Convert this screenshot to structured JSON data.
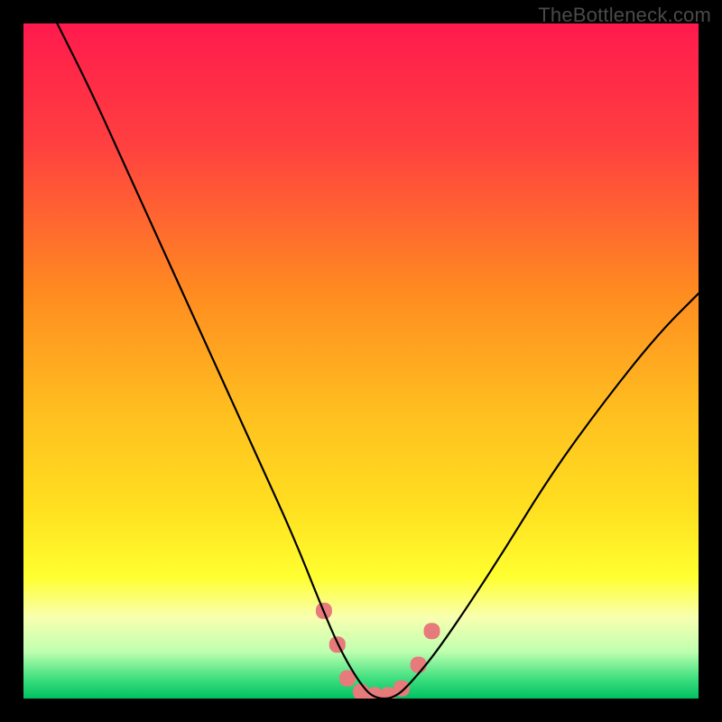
{
  "watermark": "TheBottleneck.com",
  "colors": {
    "frame": "#000000",
    "gradient_stops": [
      {
        "pos": 0.0,
        "color": "#ff1a4d"
      },
      {
        "pos": 0.18,
        "color": "#ff4040"
      },
      {
        "pos": 0.4,
        "color": "#ff8c20"
      },
      {
        "pos": 0.58,
        "color": "#ffc020"
      },
      {
        "pos": 0.72,
        "color": "#ffe020"
      },
      {
        "pos": 0.82,
        "color": "#ffff30"
      },
      {
        "pos": 0.88,
        "color": "#f8ffb0"
      },
      {
        "pos": 0.93,
        "color": "#c0ffb0"
      },
      {
        "pos": 0.97,
        "color": "#40e080"
      },
      {
        "pos": 1.0,
        "color": "#00c060"
      }
    ],
    "curve": "#000000",
    "marker_fill": "#e77a7a",
    "marker_stroke": "#d06060"
  },
  "chart_data": {
    "type": "line",
    "title": "",
    "xlabel": "",
    "ylabel": "",
    "xlim": [
      0,
      100
    ],
    "ylim": [
      0,
      100
    ],
    "note": "A bottleneck-style V curve. x is an implicit hardware-balance axis; y is bottleneck percentage (higher = worse, red; lower = better, green). Minimum near x≈52 at y=0. Values are read off pixel positions in a 748×748 plot area since no axes are labeled.",
    "series": [
      {
        "name": "bottleneck_curve",
        "x": [
          5,
          10,
          15,
          20,
          25,
          30,
          35,
          40,
          44,
          47,
          50,
          52,
          55,
          58,
          62,
          70,
          78,
          86,
          94,
          100
        ],
        "y": [
          100,
          90,
          79,
          68,
          57,
          46,
          35,
          24,
          14,
          7,
          2,
          0,
          0,
          3,
          8,
          20,
          33,
          44,
          54,
          60
        ]
      }
    ],
    "markers": {
      "name": "highlighted_points",
      "note": "Pink rounded markers clustered around the valley (left and right shoulders plus the flat bottom).",
      "x": [
        44.5,
        46.5,
        48,
        50,
        52,
        54,
        56,
        58.5,
        60.5
      ],
      "y": [
        13,
        8,
        3,
        1,
        0.5,
        0.5,
        1.5,
        5,
        10
      ]
    }
  }
}
